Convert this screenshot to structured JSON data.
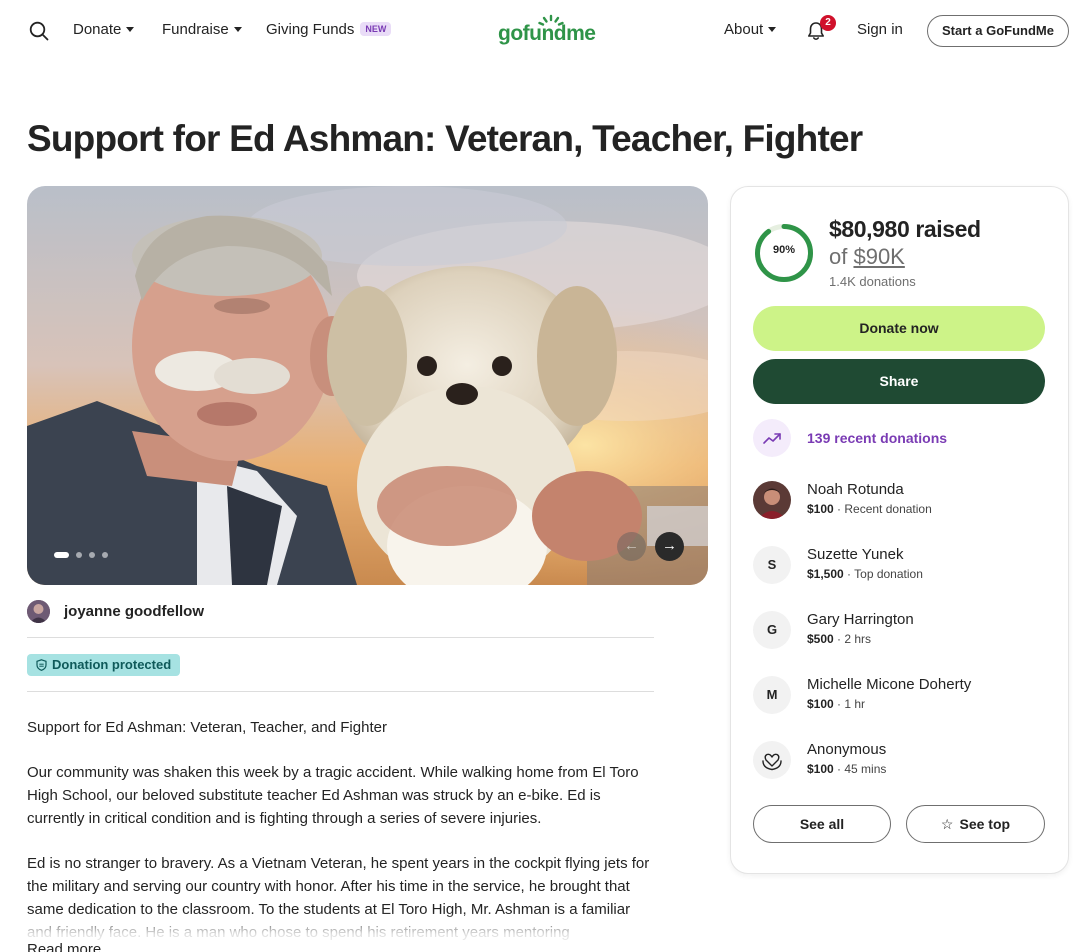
{
  "header": {
    "nav": {
      "donate": "Donate",
      "fundraise": "Fundraise",
      "giving_funds": "Giving Funds",
      "new_badge": "NEW",
      "about": "About",
      "sign_in": "Sign in",
      "start_button": "Start a GoFundMe"
    },
    "logo_text": "gofundme",
    "notification_count": "2",
    "icons": {
      "search": "search-icon",
      "bell": "bell-icon"
    }
  },
  "campaign": {
    "title": "Support for Ed Ashman: Veteran, Teacher, Fighter",
    "organizer": "joyanne goodfellow",
    "protection_badge": "Donation protected",
    "gallery": {
      "slide_count": 4,
      "active_slide": 1,
      "prev_icon": "arrow-left-icon",
      "next_icon": "arrow-right-icon"
    },
    "story": {
      "paragraphs": [
        "Support for Ed Ashman: Veteran, Teacher, and Fighter",
        "Our community was shaken this week by a tragic accident. While walking home from El Toro High School, our beloved substitute teacher Ed Ashman was struck by an e-bike. Ed is currently in critical condition and is fighting through a series of severe injuries.",
        "Ed is no stranger to bravery. As a Vietnam Veteran, he spent years in the cockpit flying jets for the military and serving our country with honor. After his time in the service, he brought that same dedication to the classroom. To the students at El Toro High, Mr. Ashman is a familiar and friendly face. He is a man who chose to spend his retirement years mentoring"
      ],
      "read_more": "Read more"
    }
  },
  "sidebar": {
    "progress_percent": 90,
    "progress_label": "90%",
    "raised_text": "$80,980 raised",
    "goal_prefix": "of ",
    "goal_amount": "$90K",
    "donations_count": "1.4K donations",
    "donate_button": "Donate now",
    "share_button": "Share",
    "recent_donations_link": "139 recent donations",
    "colors": {
      "progress": "#2f9448",
      "donate_bg": "#cdf388",
      "share_bg": "#1f4a33",
      "accent_purple": "#7a3bb4"
    },
    "donors": [
      {
        "initial": "",
        "avatar": "photo",
        "name": "Noah Rotunda",
        "amount": "$100",
        "note": " · Recent donation"
      },
      {
        "initial": "S",
        "avatar": "letter",
        "name": "Suzette Yunek",
        "amount": "$1,500",
        "note": " · Top donation"
      },
      {
        "initial": "G",
        "avatar": "letter",
        "name": "Gary Harrington",
        "amount": "$500",
        "note": " · 2 hrs"
      },
      {
        "initial": "M",
        "avatar": "letter",
        "name": "Michelle Micone Doherty",
        "amount": "$100",
        "note": " · 1 hr"
      },
      {
        "initial": "",
        "avatar": "heart-hands-icon",
        "name": "Anonymous",
        "amount": "$100",
        "note": " · 45 mins"
      }
    ],
    "see_all_button": "See all",
    "see_top_button": "See top",
    "see_top_icon": "star-icon"
  }
}
